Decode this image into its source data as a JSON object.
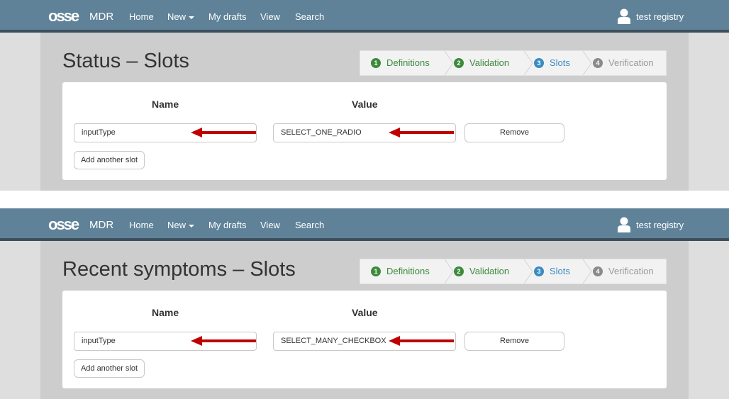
{
  "nav": {
    "brand": "MDR",
    "links": [
      "Home",
      "New",
      "My drafts",
      "View",
      "Search"
    ],
    "user": "test registry"
  },
  "steps": [
    {
      "num": "1",
      "label": "Definitions"
    },
    {
      "num": "2",
      "label": "Validation"
    },
    {
      "num": "3",
      "label": "Slots"
    },
    {
      "num": "4",
      "label": "Verification"
    }
  ],
  "columns": {
    "name": "Name",
    "value": "Value"
  },
  "buttons": {
    "remove": "Remove",
    "add": "Add another slot"
  },
  "colors": {
    "navbar": "#5f8299",
    "step_done": "#3d8a3d",
    "step_active": "#3b8bc2",
    "step_pending": "#8a8a8a",
    "arrow": "#c00000"
  },
  "panels": [
    {
      "title": "Status – Slots",
      "slot_name": "inputType",
      "slot_value": "SELECT_ONE_RADIO"
    },
    {
      "title": "Recent symptoms – Slots",
      "slot_name": "inputType",
      "slot_value": "SELECT_MANY_CHECKBOX"
    }
  ]
}
